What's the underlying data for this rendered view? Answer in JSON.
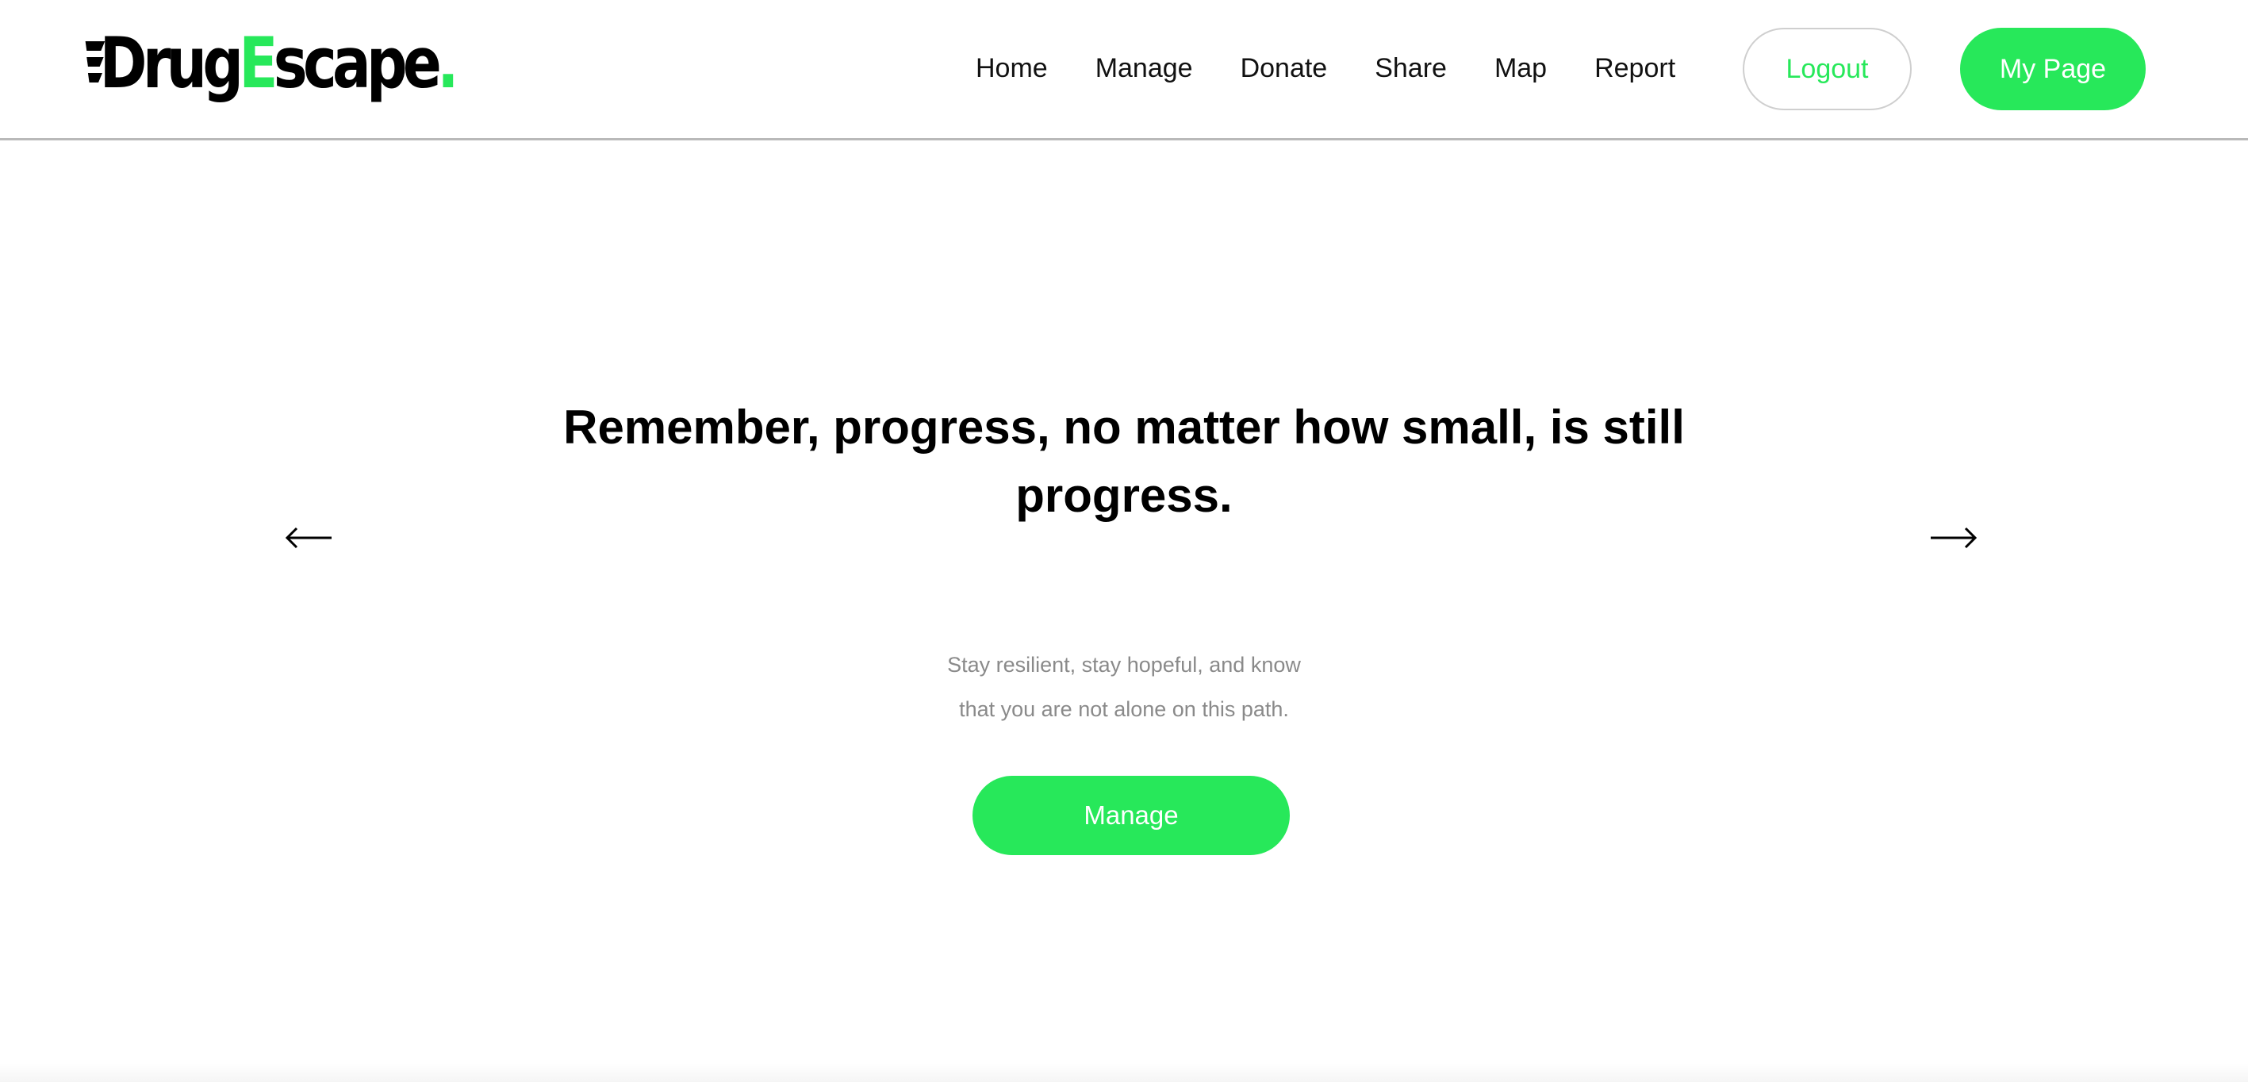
{
  "brand": {
    "logo_part1": "Drug",
    "logo_accent": "E",
    "logo_part2": "scape",
    "logo_dot": ".",
    "accent_color": "#27e85a"
  },
  "nav": {
    "items": [
      {
        "label": "Home"
      },
      {
        "label": "Manage"
      },
      {
        "label": "Donate"
      },
      {
        "label": "Share"
      },
      {
        "label": "Map"
      },
      {
        "label": "Report"
      }
    ],
    "logout_label": "Logout",
    "mypage_label": "My Page"
  },
  "hero": {
    "headline": "Remember, progress, no matter how small, is still progress.",
    "subtext_line1": "Stay resilient, stay hopeful, and know",
    "subtext_line2": "that you are not alone on this path.",
    "cta_label": "Manage",
    "prev_icon": "arrow-left-icon",
    "next_icon": "arrow-right-icon"
  }
}
